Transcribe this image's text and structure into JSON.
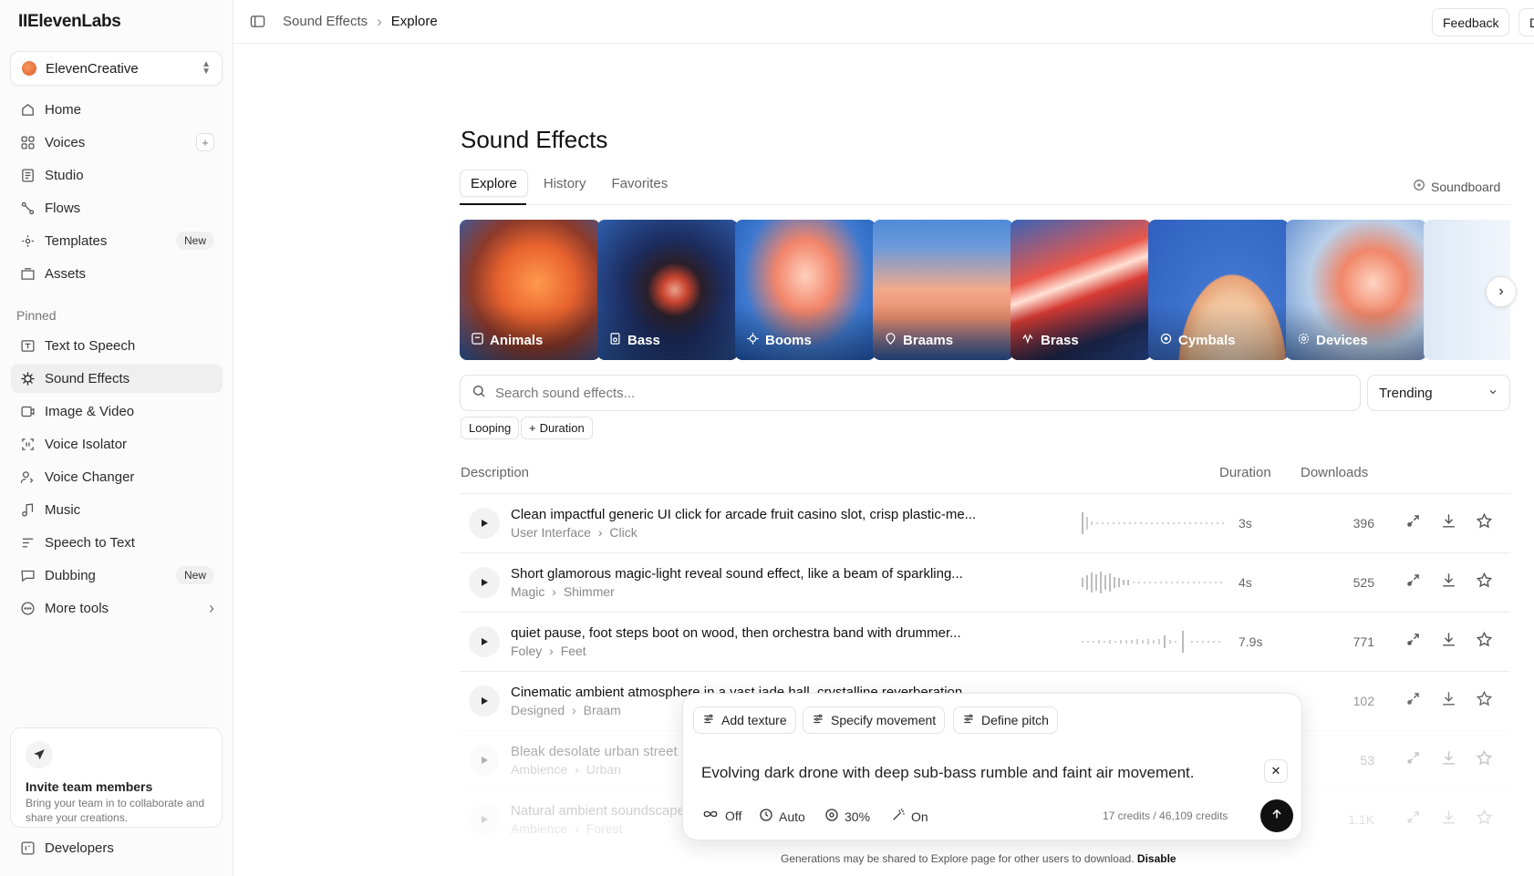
{
  "app": {
    "logo": "IIElevenLabs"
  },
  "workspace": {
    "name": "ElevenCreative"
  },
  "sidebar": {
    "main": [
      {
        "label": "Home",
        "icon": "home-icon"
      },
      {
        "label": "Voices",
        "icon": "voices-icon",
        "action": "+"
      },
      {
        "label": "Studio",
        "icon": "studio-icon"
      },
      {
        "label": "Flows",
        "icon": "flows-icon"
      },
      {
        "label": "Templates",
        "icon": "templates-icon",
        "badge": "New"
      },
      {
        "label": "Assets",
        "icon": "assets-icon"
      }
    ],
    "pinned_label": "Pinned",
    "pinned": [
      {
        "label": "Text to Speech",
        "icon": "text-to-speech-icon"
      },
      {
        "label": "Sound Effects",
        "icon": "sound-effects-icon",
        "active": true
      },
      {
        "label": "Image & Video",
        "icon": "image-video-icon"
      },
      {
        "label": "Voice Isolator",
        "icon": "voice-isolator-icon"
      },
      {
        "label": "Voice Changer",
        "icon": "voice-changer-icon"
      },
      {
        "label": "Music",
        "icon": "music-icon"
      },
      {
        "label": "Speech to Text",
        "icon": "speech-to-text-icon"
      },
      {
        "label": "Dubbing",
        "icon": "dubbing-icon",
        "badge": "New"
      },
      {
        "label": "More tools",
        "icon": "more-tools-icon",
        "chevron": "›"
      }
    ],
    "invite": {
      "title": "Invite team members",
      "subtitle": "Bring your team in to collaborate and share your creations."
    },
    "developers": "Developers"
  },
  "topbar": {
    "breadcrumb": [
      "Sound Effects",
      "Explore"
    ],
    "feedback": "Feedback",
    "cut_button": "Do"
  },
  "main": {
    "title": "Sound Effects",
    "tabs": [
      "Explore",
      "History",
      "Favorites"
    ],
    "soundboard": "Soundboard",
    "categories": [
      {
        "label": "Animals",
        "colors": [
          "#e8733a",
          "#2f5fae"
        ]
      },
      {
        "label": "Bass",
        "colors": [
          "#c7442e",
          "#1d3f8f"
        ]
      },
      {
        "label": "Booms",
        "colors": [
          "#f08a6b",
          "#2a69c4"
        ]
      },
      {
        "label": "Braams",
        "colors": [
          "#f2a07c",
          "#3c7fd1"
        ]
      },
      {
        "label": "Brass",
        "colors": [
          "#e5533d",
          "#2b4e9e"
        ]
      },
      {
        "label": "Cymbals",
        "colors": [
          "#f4c8a2",
          "#2f5fbf"
        ]
      },
      {
        "label": "Devices",
        "colors": [
          "#e77a55",
          "#8fb3de"
        ]
      }
    ],
    "search_placeholder": "Search sound effects...",
    "sort": "Trending",
    "filters": [
      "Looping",
      "Duration"
    ],
    "columns": {
      "description": "Description",
      "duration": "Duration",
      "downloads": "Downloads"
    },
    "rows": [
      {
        "desc": "Clean impactful generic UI click for arcade fruit casino slot, crisp plastic-me...",
        "cat": "User Interface",
        "sub": "Click",
        "duration": "3s",
        "downloads": "396"
      },
      {
        "desc": "Short glamorous magic-light reveal sound effect, like a beam of sparkling...",
        "cat": "Magic",
        "sub": "Shimmer",
        "duration": "4s",
        "downloads": "525"
      },
      {
        "desc": "quiet pause, foot steps boot on wood, then orchestra band with drummer...",
        "cat": "Foley",
        "sub": "Feet",
        "duration": "7.9s",
        "downloads": "771"
      },
      {
        "desc": "Cinematic ambient atmosphere in a vast jade hall, crystalline reverberation",
        "cat": "Designed",
        "sub": "Braam",
        "duration": "",
        "downloads": "102"
      },
      {
        "desc": "Bleak desolate urban street",
        "cat": "Ambience",
        "sub": "Urban",
        "duration": "",
        "downloads": "53"
      },
      {
        "desc": "Natural ambient soundscape",
        "cat": "Ambience",
        "sub": "Forest",
        "duration": "",
        "downloads": "1.1K"
      }
    ]
  },
  "prompt": {
    "chips": [
      "Add texture",
      "Specify movement",
      "Define pitch"
    ],
    "text": "Evolving dark drone with deep sub-bass rumble and faint air movement.",
    "options": {
      "loop": "Off",
      "duration": "Auto",
      "influence": "30%",
      "enhance": "On"
    },
    "credits": "17 credits / 46,109 credits",
    "footnote": "Generations may be shared to Explore page for other users to download.",
    "disable": "Disable"
  }
}
